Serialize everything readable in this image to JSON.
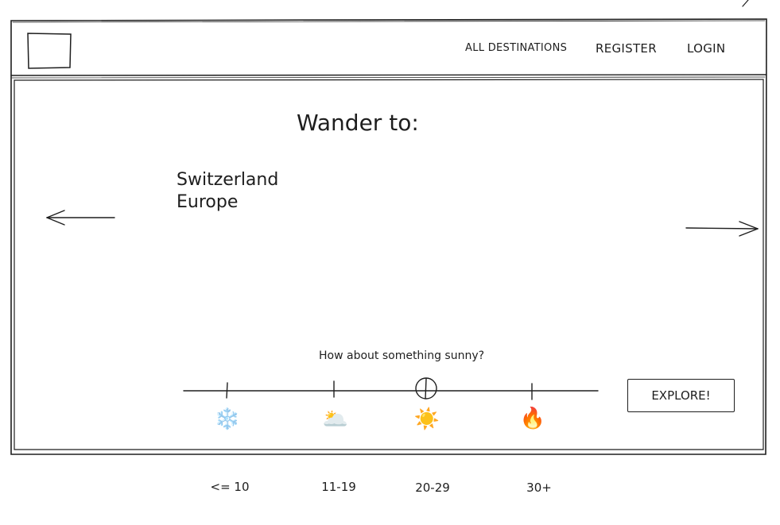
{
  "nav": {
    "items": [
      "ALL DESTINATIONS",
      "REGISTER",
      "LOGIN"
    ]
  },
  "main": {
    "title": "Wander to:",
    "destination": {
      "country": "Switzerland",
      "region": "Europe"
    }
  },
  "weather": {
    "question": "How about something sunny?",
    "options": [
      {
        "icon": "snowflake-icon",
        "emoji": "❄️",
        "range": "<= 10"
      },
      {
        "icon": "sun-behind-cloud-icon",
        "emoji": "🌥️",
        "range": "11-19"
      },
      {
        "icon": "sun-icon",
        "emoji": "☀️",
        "range": "20-29"
      },
      {
        "icon": "fire-icon",
        "emoji": "🔥",
        "range": "30+"
      }
    ],
    "selected_index": 2,
    "explore_label": "EXPLORE!"
  }
}
